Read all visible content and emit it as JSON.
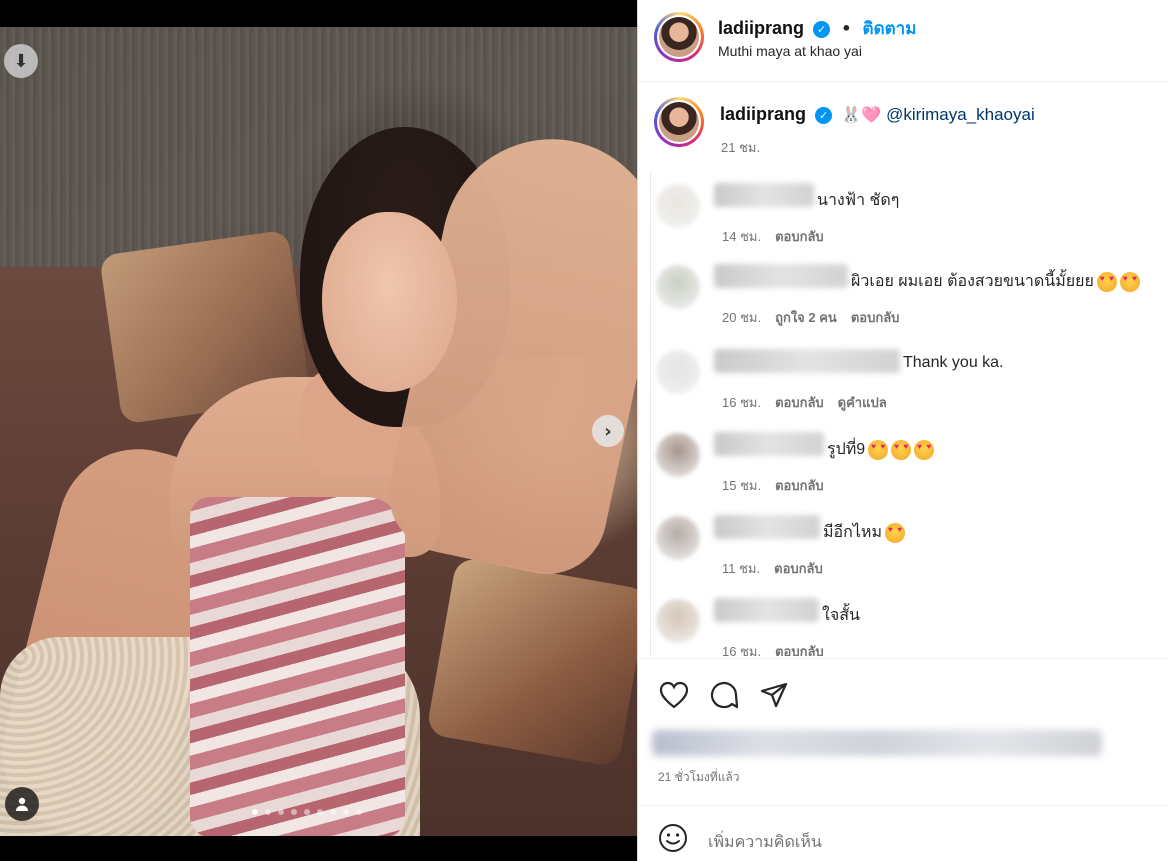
{
  "post": {
    "username": "ladiiprang",
    "follow_label": "ติดตาม",
    "location": "Muthi maya at khao yai",
    "caption_emoji": "🐰🩷",
    "caption_mention": "@kirimaya_khaoyai",
    "caption_time": "21 ชม.",
    "posted_ago": "21 ชั่วโมงที่แล้ว",
    "add_comment_placeholder": "เพิ่มความคิดเห็น",
    "carousel": {
      "count": 9,
      "active_index": 0
    }
  },
  "comments": [
    {
      "text": "นางฟ้า ชัดๆ",
      "time": "14 ชม.",
      "likes": "",
      "reply": "ตอบกลับ",
      "translate": "",
      "emoji_count": 0
    },
    {
      "text": "ผิวเอย ผมเอย ต้องสวยขนาดนี้มั้ยยย",
      "time": "20 ชม.",
      "likes": "ถูกใจ 2 คน",
      "reply": "ตอบกลับ",
      "translate": "",
      "emoji_count": 2
    },
    {
      "text": "Thank you ka.",
      "time": "16 ชม.",
      "likes": "",
      "reply": "ตอบกลับ",
      "translate": "ดูคำแปล",
      "emoji_count": 0
    },
    {
      "text": "รูปที่9",
      "time": "15 ชม.",
      "likes": "",
      "reply": "ตอบกลับ",
      "translate": "",
      "emoji_count": 3
    },
    {
      "text": "มีอีกไหม",
      "time": "11 ชม.",
      "likes": "",
      "reply": "ตอบกลับ",
      "translate": "",
      "emoji_count": 1
    },
    {
      "text": "ใจสั้น",
      "time": "16 ชม.",
      "likes": "",
      "reply": "ตอบกลับ",
      "translate": "",
      "emoji_count": 0
    }
  ],
  "icons": {
    "download": "arrow-down-icon",
    "next": "chevron-right-icon",
    "tagged_user": "user-icon",
    "like": "heart-icon",
    "comment": "comment-icon",
    "share": "send-icon",
    "emoji": "smiley-icon",
    "verified": "verified-badge-icon"
  },
  "colors": {
    "accent": "#0095f6",
    "mention": "#00376b",
    "muted": "#737373"
  }
}
